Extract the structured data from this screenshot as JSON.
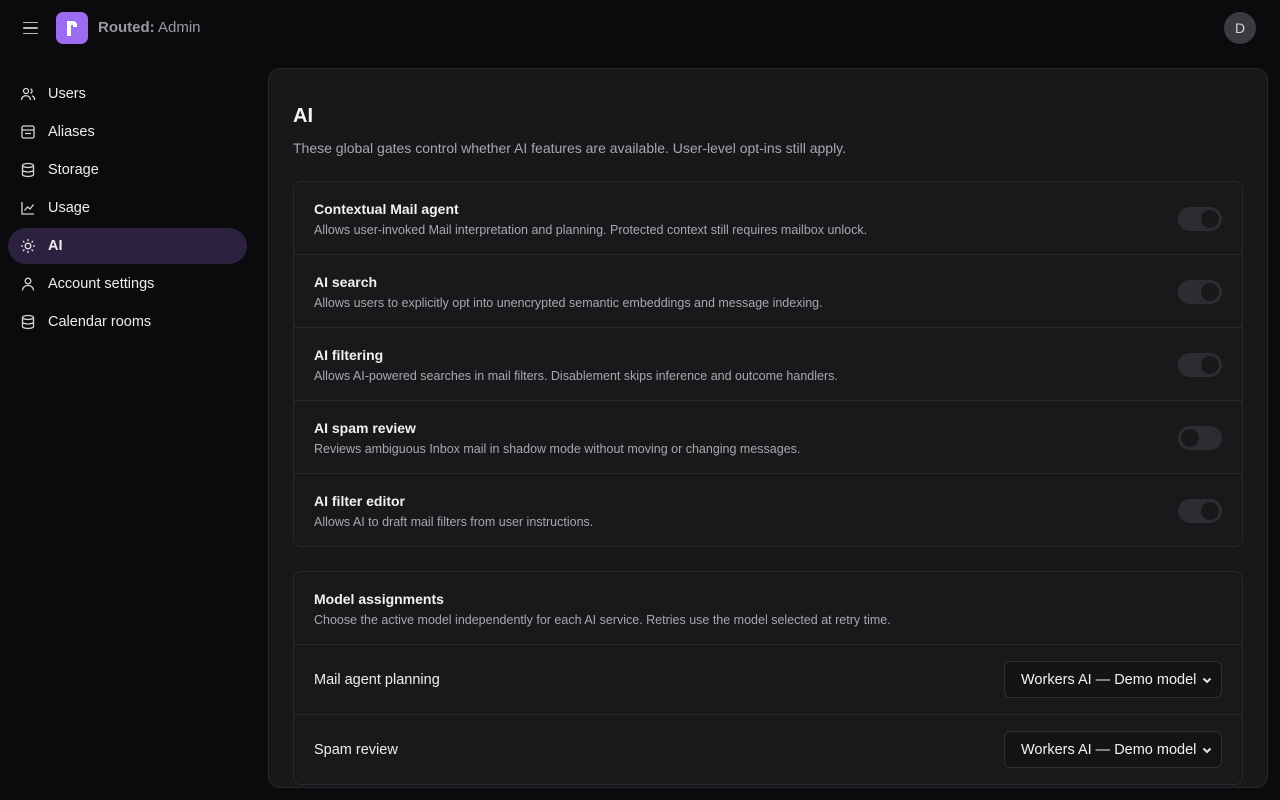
{
  "app": {
    "brand_bold": "Routed:",
    "brand_rest": " Admin",
    "avatar_initial": "D"
  },
  "sidebar": {
    "items": [
      {
        "label": "Users",
        "icon": "users-icon",
        "active": false
      },
      {
        "label": "Aliases",
        "icon": "alias-icon",
        "active": false
      },
      {
        "label": "Storage",
        "icon": "database-icon",
        "active": false
      },
      {
        "label": "Usage",
        "icon": "chart-icon",
        "active": false
      },
      {
        "label": "AI",
        "icon": "sun-icon",
        "active": true
      },
      {
        "label": "Account settings",
        "icon": "user-icon",
        "active": false
      },
      {
        "label": "Calendar rooms",
        "icon": "database-icon",
        "active": false
      }
    ]
  },
  "main": {
    "title": "AI",
    "description": "These global gates control whether AI features are available. User-level opt-ins still apply.",
    "gates": [
      {
        "title": "Contextual Mail agent",
        "desc": "Allows user-invoked Mail interpretation and planning. Protected context still requires mailbox unlock.",
        "enabled": true
      },
      {
        "title": "AI search",
        "desc": "Allows users to explicitly opt into unencrypted semantic embeddings and message indexing.",
        "enabled": true
      },
      {
        "title": "AI filtering",
        "desc": "Allows AI-powered searches in mail filters. Disablement skips inference and outcome handlers.",
        "enabled": true
      },
      {
        "title": "AI spam review",
        "desc": "Reviews ambiguous Inbox mail in shadow mode without moving or changing messages.",
        "enabled": false
      },
      {
        "title": "AI filter editor",
        "desc": "Allows AI to draft mail filters from user instructions.",
        "enabled": true
      }
    ],
    "models": {
      "title": "Model assignments",
      "desc": "Choose the active model independently for each AI service. Retries use the model selected at retry time.",
      "rows": [
        {
          "label": "Mail agent planning",
          "value": "Workers AI — Demo model"
        },
        {
          "label": "Spam review",
          "value": "Workers AI — Demo model"
        }
      ]
    }
  },
  "colors": {
    "accent": "#9b6cf0",
    "active_nav_bg": "#2c2240",
    "panel_bg": "#18181b",
    "page_bg": "#0b0b0d"
  }
}
